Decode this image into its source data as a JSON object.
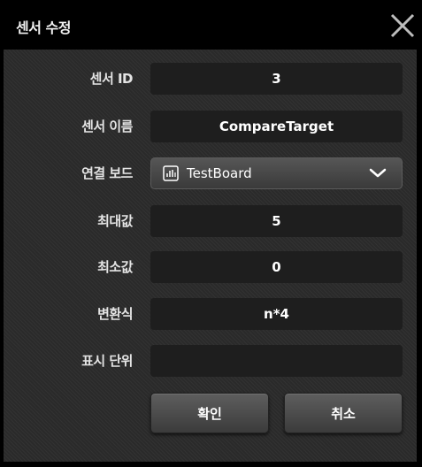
{
  "dialog": {
    "title": "센서 수정",
    "close_icon": "close-x-icon"
  },
  "form": {
    "sensor_id": {
      "label": "센서 ID",
      "value": "3"
    },
    "sensor_name": {
      "label": "센서 이름",
      "value": "CompareTarget"
    },
    "connected_board": {
      "label": "연결 보드",
      "value": "TestBoard",
      "icon": "board-icon",
      "dropdown_icon": "chevron-down-icon"
    },
    "max_value": {
      "label": "최대값",
      "value": "5"
    },
    "min_value": {
      "label": "최소값",
      "value": "0"
    },
    "formula": {
      "label": "변환식",
      "value": "n*4"
    },
    "display_unit": {
      "label": "표시 단위",
      "value": ""
    }
  },
  "buttons": {
    "confirm_label": "확인",
    "cancel_label": "취소"
  },
  "colors": {
    "background": "#000000",
    "panel": "#2a2a2a",
    "field": "#1e1e1e",
    "text": "#ffffff"
  }
}
